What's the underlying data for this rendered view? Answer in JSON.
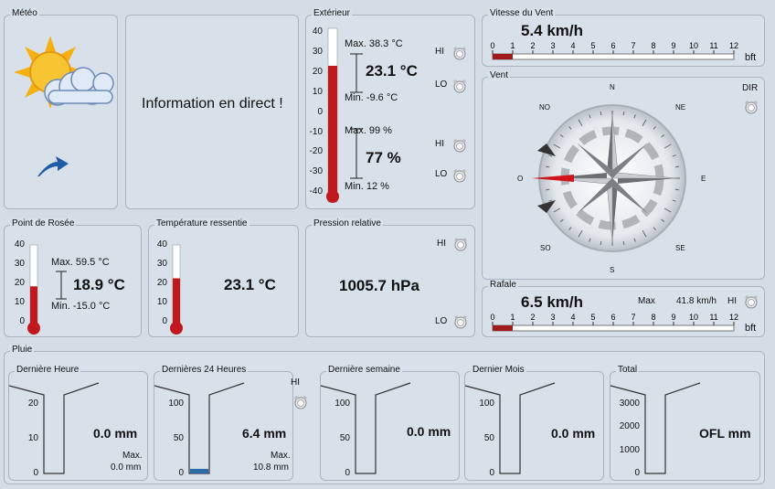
{
  "meteo": {
    "title": "Météo",
    "info_text": "Information en direct !"
  },
  "exterieur": {
    "title": "Extérieur",
    "temp_ticks": [
      "40",
      "30",
      "20",
      "10",
      "0",
      "-10",
      "-20",
      "-30",
      "-40"
    ],
    "temp_value": "23.1 °C",
    "temp_level": 23.1,
    "temp_max": "Max. 38.3 °C",
    "temp_min": "Min. -9.6 °C",
    "hum_value": "77 %",
    "hum_max": "Max. 99 %",
    "hum_min": "Min. 12 %",
    "hi": "HI",
    "lo": "LO"
  },
  "vitesse_vent": {
    "title": "Vitesse du Vent",
    "value": "5.4 km/h",
    "scale": [
      "0",
      "1",
      "2",
      "3",
      "4",
      "5",
      "6",
      "7",
      "8",
      "9",
      "10",
      "11",
      "12"
    ],
    "unit": "bft",
    "level_bft": 1
  },
  "vent": {
    "title": "Vent",
    "dir_label": "DIR",
    "points": {
      "n": "N",
      "ne": "NE",
      "e": "E",
      "se": "SE",
      "s": "S",
      "so": "SO",
      "o": "O",
      "no": "NO"
    },
    "direction_deg": 270
  },
  "rosee": {
    "title": "Point de Rosée",
    "ticks": [
      "40",
      "30",
      "20",
      "10",
      "0"
    ],
    "value": "18.9 °C",
    "level": 18.9,
    "max": "Max. 59.5 °C",
    "min": "Min. -15.0 °C"
  },
  "ressentie": {
    "title": "Température ressentie",
    "ticks": [
      "40",
      "30",
      "20",
      "10",
      "0"
    ],
    "value": "23.1 °C",
    "level": 23.1
  },
  "pression": {
    "title": "Pression relative",
    "value": "1005.7 hPa",
    "hi": "HI",
    "lo": "LO"
  },
  "rafale": {
    "title": "Rafale",
    "value": "6.5 km/h",
    "max_label": "Max",
    "max_value": "41.8 km/h",
    "hi": "HI",
    "scale": [
      "0",
      "1",
      "2",
      "3",
      "4",
      "5",
      "6",
      "7",
      "8",
      "9",
      "10",
      "11",
      "12"
    ],
    "unit": "bft",
    "level_bft": 1
  },
  "pluie": {
    "title": "Pluie",
    "heure": {
      "title": "Dernière Heure",
      "ticks": [
        "20",
        "10",
        "0"
      ],
      "value": "0.0 mm",
      "max_label": "Max.",
      "max_value": "0.0 mm",
      "level": 0
    },
    "jour": {
      "title": "Dernières 24 Heures",
      "ticks": [
        "100",
        "50",
        "0"
      ],
      "value": "6.4 mm",
      "max_label": "Max.",
      "max_value": "10.8 mm",
      "hi": "HI",
      "level": 6.4
    },
    "semaine": {
      "title": "Dernière semaine",
      "ticks": [
        "100",
        "50",
        "0"
      ],
      "value": "0.0 mm",
      "level": 0
    },
    "mois": {
      "title": "Dernier Mois",
      "ticks": [
        "100",
        "50",
        "0"
      ],
      "value": "0.0 mm",
      "level": 0
    },
    "total": {
      "title": "Total",
      "ticks": [
        "3000",
        "2000",
        "1000",
        "0"
      ],
      "value": "OFL mm",
      "level": 0
    }
  },
  "colors": {
    "mercury": "#c0181c",
    "rain": "#2f6aa8",
    "bar": "#a01a1a"
  }
}
